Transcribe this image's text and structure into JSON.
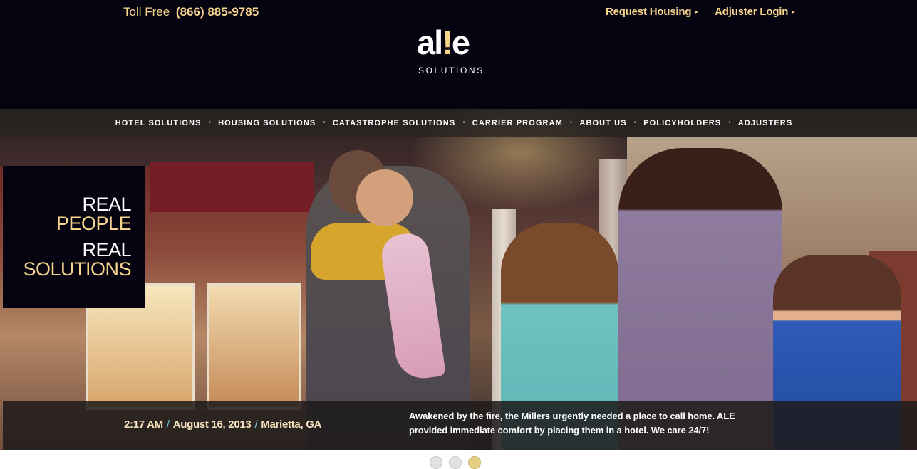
{
  "header": {
    "toll_free_label": "Toll Free",
    "toll_free_number": "(866) 885-9785",
    "links": [
      {
        "label": "Request Housing"
      },
      {
        "label": "Adjuster Login"
      }
    ],
    "logo": {
      "word_a_l": "al",
      "word_exclaim": "!",
      "word_e": "e",
      "sub": "SOLUTIONS"
    }
  },
  "nav": {
    "items": [
      {
        "label": "HOTEL SOLUTIONS"
      },
      {
        "label": "HOUSING SOLUTIONS"
      },
      {
        "label": "CATASTROPHE SOLUTIONS"
      },
      {
        "label": "CARRIER PROGRAM"
      },
      {
        "label": "ABOUT US"
      },
      {
        "label": "POLICYHOLDERS"
      },
      {
        "label": "ADJUSTERS"
      }
    ],
    "separator": "•"
  },
  "hero": {
    "tagline": [
      "REAL",
      "PEOPLE",
      "REAL",
      "SOLUTIONS"
    ],
    "caption": {
      "time": "2:17 AM",
      "date": "August 16, 2013",
      "location": "Marietta, GA",
      "separator": "/",
      "text": "Awakened by the fire, the Millers urgently needed a place to call home. ALE provided immediate comfort by placing them in a hotel. We care 24/7!"
    }
  },
  "slider": {
    "active_index": 2,
    "count": 3
  },
  "colors": {
    "header_bg": "#04030f",
    "accent_gold": "#f6d48b",
    "caption_slash": "#6fc5e0"
  }
}
